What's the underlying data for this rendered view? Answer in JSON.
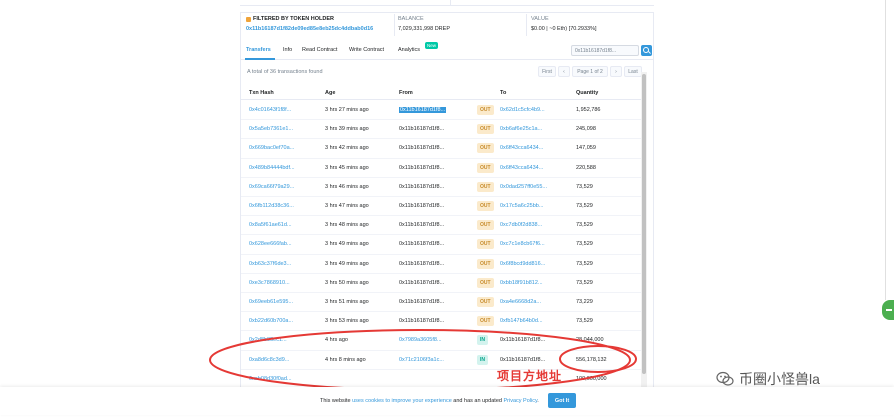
{
  "header": {
    "holder_label": "FILTERED BY TOKEN HOLDER",
    "holder_address": "0x11b16187d1f82de09ed85e8eb25dc4ddbab0d16",
    "balance_label": "BALANCE",
    "balance_value": "7,029,331,998 DREP",
    "value_label": "VALUE",
    "value_value": "$0.00 | ~0 Eth) [70.2933%]"
  },
  "tabs": {
    "items": [
      "Transfers",
      "Info",
      "Read Contract",
      "Write Contract",
      "Analytics"
    ],
    "new_badge": "New",
    "filter_value": "0x11b16187d1f8..."
  },
  "summary": {
    "total_text": "A total of 36 transactions found"
  },
  "pager": {
    "first": "First",
    "prev": "‹",
    "page": "Page 1 of 2",
    "next": "›",
    "last": "Last"
  },
  "table": {
    "headers": [
      "Txn Hash",
      "Age",
      "From",
      "",
      "To",
      "Quantity"
    ],
    "rows": [
      {
        "hash": "0x4c01643f1f8f...",
        "age": "3 hrs 27 mins ago",
        "from": "0x11b16187d1f8...",
        "dir": "OUT",
        "to": "0x62d1c5cfc4b9...",
        "qty": "1,952,786"
      },
      {
        "hash": "0x5a5eb7361e1...",
        "age": "3 hrs 39 mins ago",
        "from": "0x11b16187d1f8...",
        "dir": "OUT",
        "to": "0xb6af6e25c1a...",
        "qty": "245,098"
      },
      {
        "hash": "0x669bac0ef70a...",
        "age": "3 hrs 42 mins ago",
        "from": "0x11b16187d1f8...",
        "dir": "OUT",
        "to": "0x6ff43cca6434...",
        "qty": "147,059"
      },
      {
        "hash": "0x489b84444bdf...",
        "age": "3 hrs 45 mins ago",
        "from": "0x11b16187d1f8...",
        "dir": "OUT",
        "to": "0x6ff43cca6434...",
        "qty": "220,588"
      },
      {
        "hash": "0x69ca66f79a29...",
        "age": "3 hrs 46 mins ago",
        "from": "0x11b16187d1f8...",
        "dir": "OUT",
        "to": "0x0dad257ff0e55...",
        "qty": "73,529"
      },
      {
        "hash": "0x6fb112d38c36...",
        "age": "3 hrs 47 mins ago",
        "from": "0x11b16187d1f8...",
        "dir": "OUT",
        "to": "0x17c5a6c25bb...",
        "qty": "73,529"
      },
      {
        "hash": "0x8a5f61ae61d...",
        "age": "3 hrs 48 mins ago",
        "from": "0x11b16187d1f8...",
        "dir": "OUT",
        "to": "0xc7db0f2d838...",
        "qty": "73,529"
      },
      {
        "hash": "0x628ee666fab...",
        "age": "3 hrs 49 mins ago",
        "from": "0x11b16187d1f8...",
        "dir": "OUT",
        "to": "0xc7c1e8cb67f6...",
        "qty": "73,529"
      },
      {
        "hash": "0xb63c37f6de3...",
        "age": "3 hrs 49 mins ago",
        "from": "0x11b16187d1f8...",
        "dir": "OUT",
        "to": "0x6f8bcd9dd816...",
        "qty": "73,529"
      },
      {
        "hash": "0xe3c7868910...",
        "age": "3 hrs 50 mins ago",
        "from": "0x11b16187d1f8...",
        "dir": "OUT",
        "to": "0xbb18f91b812...",
        "qty": "73,529"
      },
      {
        "hash": "0x69eeb61e595...",
        "age": "3 hrs 51 mins ago",
        "from": "0x11b16187d1f8...",
        "dir": "OUT",
        "to": "0xa4e6668d2a...",
        "qty": "73,229"
      },
      {
        "hash": "0xb22d60b700a...",
        "age": "3 hrs 53 mins ago",
        "from": "0x11b16187d1f8...",
        "dir": "OUT",
        "to": "0xfb147b64b0d...",
        "qty": "73,529"
      },
      {
        "hash": "0x2d8b85ec1...",
        "age": "4 hrs ago",
        "from": "0x7989a3605f8...",
        "dir": "IN",
        "to": "0x11b16187d1f8...",
        "qty": "28,044,000"
      },
      {
        "hash": "0xa8d6c8c3d9...",
        "age": "4 hrs 8 mins ago",
        "from": "0x71c2106f3a1c...",
        "dir": "IN",
        "to": "0x11b16187d1f8...",
        "qty": "556,178,132"
      },
      {
        "hash": "0xab08d30f0ad...",
        "age": "",
        "from": "",
        "dir": "",
        "to": "",
        "qty": "100,000,000"
      }
    ]
  },
  "annotation": {
    "text": "项目方地址",
    "color": "#e53935"
  },
  "cookie": {
    "pre": "This website ",
    "link1": "uses cookies to improve your experience",
    "mid": " and has an updated ",
    "link2": "Privacy Policy",
    "post": ".",
    "button": "Got It"
  },
  "watermark": {
    "text": "币圈小怪兽la"
  },
  "colors": {
    "link": "#3498db",
    "out_badge": "#fbeacb",
    "in_badge": "#d3f3ee",
    "annotation": "#e53935"
  }
}
